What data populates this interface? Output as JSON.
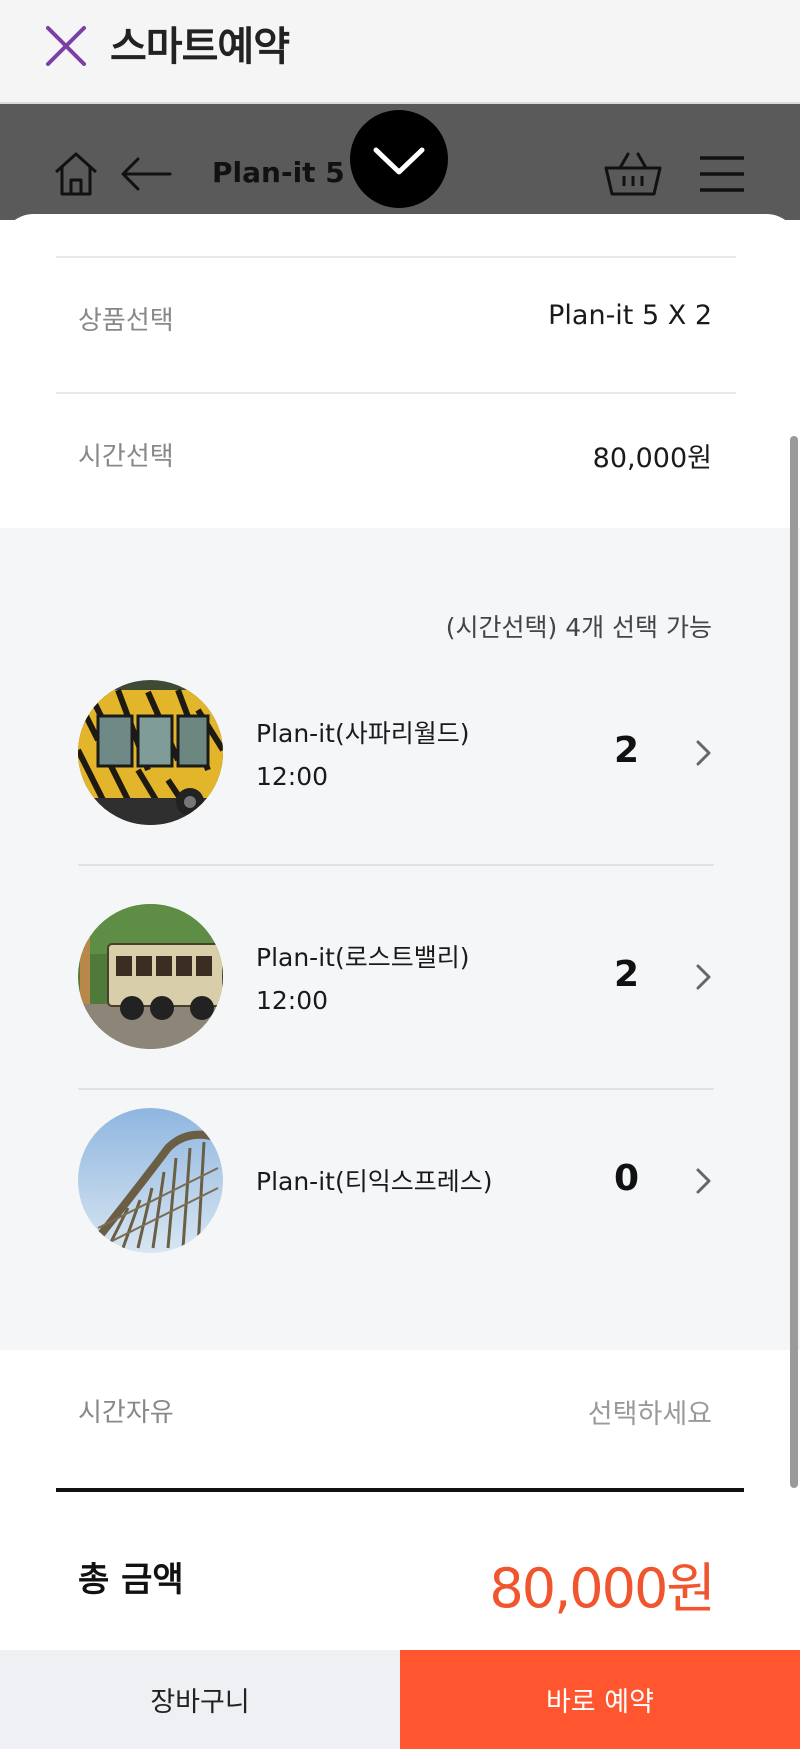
{
  "header": {
    "title": "스마트예약",
    "close_icon": "close-icon",
    "accent_color": "#7b3fa6"
  },
  "nav": {
    "title": "Plan-it 5",
    "icons": [
      "home-icon",
      "back-arrow-icon",
      "chevron-down-icon",
      "basket-icon",
      "menu-icon"
    ]
  },
  "product": {
    "label": "상품선택",
    "value": "Plan-it 5 X 2"
  },
  "time": {
    "label": "시간선택",
    "value": "80,000원"
  },
  "time_panel": {
    "note": "(시간선택) 4개 선택 가능",
    "items": [
      {
        "name": "Plan-it(사파리월드)",
        "time": "12:00",
        "count": "2"
      },
      {
        "name": "Plan-it(로스트밸리)",
        "time": "12:00",
        "count": "2"
      },
      {
        "name": "Plan-it(티익스프레스)",
        "time": "",
        "count": "0"
      }
    ]
  },
  "free_time": {
    "label": "시간자유",
    "placeholder": "선택하세요"
  },
  "total": {
    "label": "총 금액",
    "value": "80,000원",
    "color": "#f0552e"
  },
  "buttons": {
    "cart": "장바구니",
    "book": "바로 예약",
    "book_color": "#ff5630"
  }
}
